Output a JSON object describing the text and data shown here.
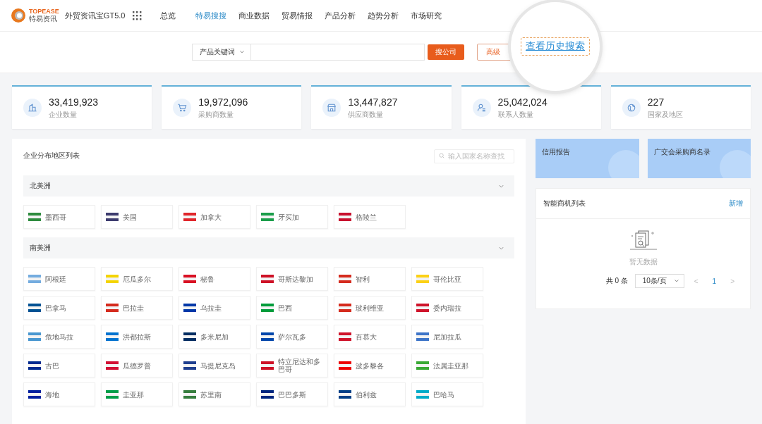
{
  "header": {
    "logo_text": "TOPEASE",
    "logo_subtext": "特易资讯",
    "product": "外贸资讯宝GT5.0",
    "nav": [
      {
        "label": "总览",
        "selected": false
      },
      {
        "label": "特易搜搜",
        "selected": true
      },
      {
        "label": "商业数据",
        "selected": false
      },
      {
        "label": "贸易情报",
        "selected": false
      },
      {
        "label": "产品分析",
        "selected": false
      },
      {
        "label": "趋势分析",
        "selected": false
      },
      {
        "label": "市场研究",
        "selected": false
      }
    ]
  },
  "search": {
    "type_select": "产品关键词",
    "search_button": "搜公司",
    "advanced_button": "高级",
    "history_link": "查看历史搜索"
  },
  "stats": [
    {
      "kind": "building",
      "value": "33,419,923",
      "label": "企业数量"
    },
    {
      "kind": "cart",
      "value": "19,972,096",
      "label": "采购商数量"
    },
    {
      "kind": "shop",
      "value": "13,447,827",
      "label": "供应商数量"
    },
    {
      "kind": "contact",
      "value": "25,042,024",
      "label": "联系人数量"
    },
    {
      "kind": "globe",
      "value": "227",
      "label": "国家及地区"
    }
  ],
  "regions": {
    "title": "企业分布地区列表",
    "filter_placeholder": "输入国家名称查找",
    "groups": [
      {
        "name": "北美洲",
        "expanded": true,
        "countries": [
          {
            "name": "墨西哥",
            "color": "#2e8b3e"
          },
          {
            "name": "美国",
            "color": "#3c3b6e"
          },
          {
            "name": "加拿大",
            "color": "#e0262b"
          },
          {
            "name": "牙买加",
            "color": "#1a9d4a"
          },
          {
            "name": "格陵兰",
            "color": "#c8102e"
          }
        ]
      },
      {
        "name": "南美洲",
        "expanded": true,
        "countries": [
          {
            "name": "阿根廷",
            "color": "#74acdf"
          },
          {
            "name": "厄瓜多尔",
            "color": "#f4d400"
          },
          {
            "name": "秘鲁",
            "color": "#d91023"
          },
          {
            "name": "哥斯达黎加",
            "color": "#ce1126"
          },
          {
            "name": "智利",
            "color": "#d52b1e"
          },
          {
            "name": "哥伦比亚",
            "color": "#fcd116"
          },
          {
            "name": "巴拿马",
            "color": "#005293"
          },
          {
            "name": "巴拉圭",
            "color": "#d52b1e"
          },
          {
            "name": "乌拉圭",
            "color": "#0038a8"
          },
          {
            "name": "巴西",
            "color": "#009c3b"
          },
          {
            "name": "玻利维亚",
            "color": "#d52b1e"
          },
          {
            "name": "委内瑞拉",
            "color": "#cf142b"
          },
          {
            "name": "危地马拉",
            "color": "#4997d0"
          },
          {
            "name": "洪都拉斯",
            "color": "#0073cf"
          },
          {
            "name": "多米尼加",
            "color": "#002d62"
          },
          {
            "name": "萨尔瓦多",
            "color": "#0047ab"
          },
          {
            "name": "百慕大",
            "color": "#cf142b"
          },
          {
            "name": "尼加拉瓜",
            "color": "#3e75c8"
          },
          {
            "name": "古巴",
            "color": "#002a8f"
          },
          {
            "name": "瓜德罗普",
            "color": "#d21034"
          },
          {
            "name": "马提尼克岛",
            "color": "#1f3f8f"
          },
          {
            "name": "特立尼达和多巴哥",
            "color": "#ce1126"
          },
          {
            "name": "波多黎各",
            "color": "#ed0000"
          },
          {
            "name": "法属圭亚那",
            "color": "#3aa935"
          },
          {
            "name": "海地",
            "color": "#00209f"
          },
          {
            "name": "圭亚那",
            "color": "#009e49"
          },
          {
            "name": "苏里南",
            "color": "#377e3f"
          },
          {
            "name": "巴巴多斯",
            "color": "#00267f"
          },
          {
            "name": "伯利兹",
            "color": "#003f87"
          },
          {
            "name": "巴哈马",
            "color": "#00abc9"
          }
        ]
      }
    ]
  },
  "promo_cards": [
    {
      "label": "信用报告"
    },
    {
      "label": "广交会采购商名录"
    }
  ],
  "opportunities": {
    "title": "智能商机列表",
    "add_link": "新增",
    "empty_text": "暂无数据",
    "total": "共 0 条",
    "page_size": "10条/页",
    "prev": "<",
    "page": "1",
    "next": ">"
  }
}
